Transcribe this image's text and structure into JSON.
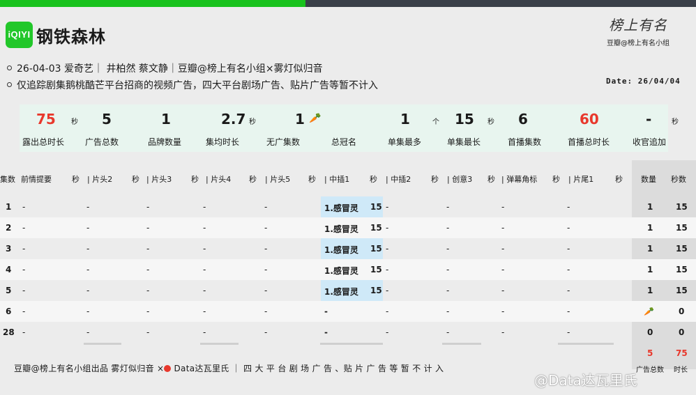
{
  "header": {
    "logo_text": "iQIYI",
    "title": "钢铁森林",
    "brand_script": "榜上有名",
    "brand_sub": "豆瓣@榜上有名小组",
    "info_line1": "26-04-03  爱奇艺｜ 井柏然 蔡文静｜豆瓣@榜上有名小组×雾灯似归音",
    "info_line2": "仅追踪剧集鹅桃酷芒平台招商的视频广告，四大平台剧场广告、贴片广告等暂不计入",
    "date": "Date: 26/04/04"
  },
  "stats": [
    {
      "value": "75",
      "unit": "秒",
      "label": "露出总时长",
      "red": true
    },
    {
      "value": "5",
      "unit": "",
      "label": "广告总数"
    },
    {
      "value": "1",
      "unit": "",
      "label": "品牌数量"
    },
    {
      "value": "2.7",
      "unit": "秒",
      "label": "集均时长"
    },
    {
      "value": "1",
      "unit": "🥕",
      "label": "无广集数"
    },
    {
      "value": "",
      "unit": "",
      "label": "总冠名"
    },
    {
      "value": "1",
      "unit": "个",
      "label": "单集最多"
    },
    {
      "value": "15",
      "unit": "秒",
      "label": "单集最长"
    },
    {
      "value": "6",
      "unit": "",
      "label": "首播集数"
    },
    {
      "value": "60",
      "unit": "",
      "label": "首播总时长",
      "red": true
    },
    {
      "value": "-",
      "unit": "秒",
      "label": "收官追加"
    }
  ],
  "table": {
    "headers": [
      "集数",
      "前情提要",
      "秒",
      "| 片头2",
      "秒",
      "| 片头3",
      "秒",
      "| 片头4",
      "秒",
      "| 片头5",
      "秒",
      "| 中插1",
      "秒",
      "| 中插2",
      "秒",
      "| 创意3",
      "秒",
      "| 弹幕角标",
      "秒",
      "| 片尾1",
      "秒",
      "数量",
      "秒数"
    ],
    "rows": [
      {
        "ep": "1",
        "cells": [
          "-",
          "-",
          "-",
          "-",
          "-",
          "1.感冒灵",
          "15",
          "-",
          "-",
          "-",
          "-"
        ],
        "count": "1",
        "secs": "15"
      },
      {
        "ep": "2",
        "cells": [
          "-",
          "-",
          "-",
          "-",
          "-",
          "1.感冒灵",
          "15",
          "-",
          "-",
          "-",
          "-"
        ],
        "count": "1",
        "secs": "15"
      },
      {
        "ep": "3",
        "cells": [
          "-",
          "-",
          "-",
          "-",
          "-",
          "1.感冒灵",
          "15",
          "-",
          "-",
          "-",
          "-"
        ],
        "count": "1",
        "secs": "15"
      },
      {
        "ep": "4",
        "cells": [
          "-",
          "-",
          "-",
          "-",
          "-",
          "1.感冒灵",
          "15",
          "-",
          "-",
          "-",
          "-"
        ],
        "count": "1",
        "secs": "15"
      },
      {
        "ep": "5",
        "cells": [
          "-",
          "-",
          "-",
          "-",
          "-",
          "1.感冒灵",
          "15",
          "-",
          "-",
          "-",
          "-"
        ],
        "count": "1",
        "secs": "15"
      },
      {
        "ep": "6",
        "cells": [
          "-",
          "-",
          "-",
          "-",
          "-",
          "-",
          "",
          "-",
          "-",
          "-",
          "-"
        ],
        "count": "🥕",
        "secs": "0"
      },
      {
        "ep": "28",
        "cells": [
          "-",
          "-",
          "-",
          "-",
          "-",
          "-",
          "",
          "-",
          "-",
          "-",
          "-"
        ],
        "count": "0",
        "secs": "0"
      }
    ],
    "total_count": "5",
    "total_secs": "75",
    "total_count_label": "广告总数",
    "total_secs_label": "时长"
  },
  "footer": {
    "text_a": "豆瓣@榜上有名小组出品  雾灯似归音 ×",
    "text_b": "Data达瓦里氏  ｜ 四 大 平 台 剧 场 广 告 、贴 片 广 告 等 暂 不 计 入",
    "watermark": "@Data达瓦里氏"
  },
  "colors": {
    "green": "#19c21d",
    "red": "#e8382c",
    "highlight": "#cfe9f8",
    "stats_bg": "#e8f5ef"
  }
}
